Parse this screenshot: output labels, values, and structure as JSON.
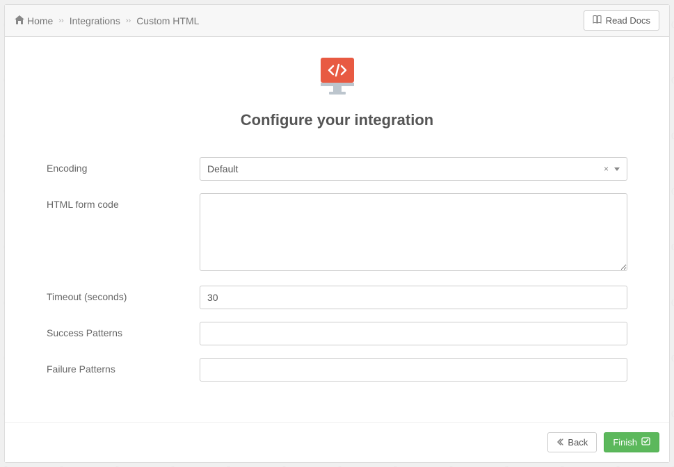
{
  "breadcrumb": {
    "home": "Home",
    "integrations": "Integrations",
    "current": "Custom HTML"
  },
  "header": {
    "read_docs": "Read Docs"
  },
  "main": {
    "title": "Configure your integration"
  },
  "form": {
    "encoding": {
      "label": "Encoding",
      "value": "Default"
    },
    "html_code": {
      "label": "HTML form code",
      "value": ""
    },
    "timeout": {
      "label": "Timeout (seconds)",
      "value": "30"
    },
    "success": {
      "label": "Success Patterns",
      "value": ""
    },
    "failure": {
      "label": "Failure Patterns",
      "value": ""
    }
  },
  "footer": {
    "back": "Back",
    "finish": "Finish"
  }
}
